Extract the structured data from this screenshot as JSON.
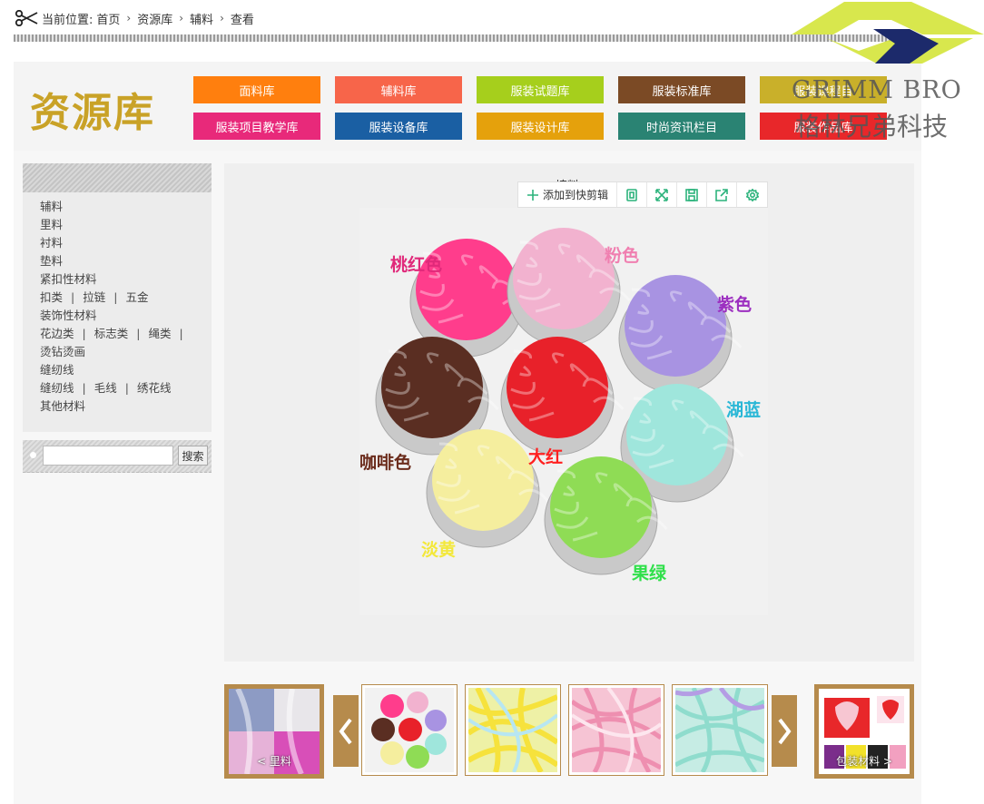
{
  "breadcrumb": {
    "prefix": "当前位置:",
    "items": [
      "首页",
      "资源库",
      "辅料",
      "查看"
    ]
  },
  "watermark": {
    "brand_en": "GRIMM BRO",
    "brand_cn": "格林兄弟科技"
  },
  "header": {
    "title": "资源库",
    "categories": [
      {
        "label": "面料库",
        "color": "#ff7f0e"
      },
      {
        "label": "辅料库",
        "color": "#f7654a"
      },
      {
        "label": "服装试题库",
        "color": "#a6cf1c"
      },
      {
        "label": "服装标准库",
        "color": "#7b4a25"
      },
      {
        "label": "服装课程目",
        "color": "#c9b02a"
      },
      {
        "label": "服装项目教学库",
        "color": "#e8297a"
      },
      {
        "label": "服装设备库",
        "color": "#1a5fa3"
      },
      {
        "label": "服装设计库",
        "color": "#e5a10c"
      },
      {
        "label": "时尚资讯栏目",
        "color": "#2a8373"
      },
      {
        "label": "服装作品库",
        "color": "#e8272a"
      }
    ]
  },
  "sidebar": {
    "items": [
      [
        "辅料"
      ],
      [
        "里料"
      ],
      [
        "衬料"
      ],
      [
        "垫料"
      ],
      [
        "紧扣性材料"
      ],
      [
        "扣类",
        "拉链",
        "五金"
      ],
      [
        "装饰性材料"
      ],
      [
        "花边类",
        "标志类",
        "绳类",
        ""
      ],
      [
        "烫钻烫画"
      ],
      [
        "缝纫线"
      ],
      [
        "缝纫线",
        "毛线",
        "绣花线"
      ],
      [
        "其他材料"
      ]
    ]
  },
  "search": {
    "placeholder": "",
    "button": "搜索"
  },
  "viewer": {
    "image_title": "填料",
    "toolbar": {
      "add_label": "添加到快剪辑",
      "icons": [
        "copy-icon",
        "fullscreen-icon",
        "save-icon",
        "share-icon",
        "settings-icon"
      ]
    },
    "photo_labels": [
      {
        "text": "桃红色",
        "color": "#e0297a"
      },
      {
        "text": "粉色",
        "color": "#f07fb0"
      },
      {
        "text": "紫色",
        "color": "#9c2fc0"
      },
      {
        "text": "湖蓝",
        "color": "#2ab7d6"
      },
      {
        "text": "咖啡色",
        "color": "#6b2c1c"
      },
      {
        "text": "大红",
        "color": "#ff2020"
      },
      {
        "text": "淡黄",
        "color": "#f3e83a"
      },
      {
        "text": "果绿",
        "color": "#2fe04a"
      }
    ],
    "bowls": [
      {
        "color": "#ff3d8c"
      },
      {
        "color": "#f2b2cf"
      },
      {
        "color": "#a893e2"
      },
      {
        "color": "#5a2e22"
      },
      {
        "color": "#e8212a"
      },
      {
        "color": "#9fe6dc"
      },
      {
        "color": "#f5ee9e"
      },
      {
        "color": "#8fdc55"
      }
    ]
  },
  "carousel": {
    "prev_caption": "< 里料",
    "next_caption": "包装材料 >",
    "thumbs": [
      "mixed",
      "yellow",
      "pink",
      "mint"
    ]
  }
}
